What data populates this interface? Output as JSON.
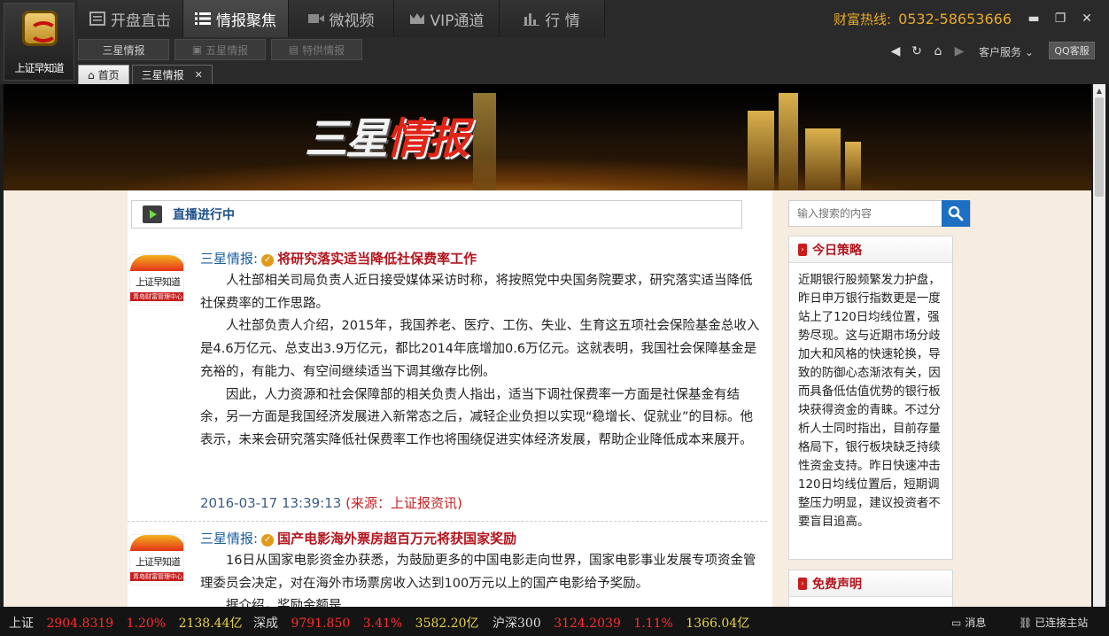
{
  "app": {
    "brand": "上证早知道",
    "hotline_label": "财富热线:",
    "hotline_number": "0532-58653666"
  },
  "main_nav": [
    {
      "label": "开盘直击",
      "icon": "list-icon"
    },
    {
      "label": "情报聚焦",
      "icon": "menu-list-icon"
    },
    {
      "label": "微视频",
      "icon": "video-camera-icon"
    },
    {
      "label": "VIP通道",
      "icon": "crown-icon"
    },
    {
      "label": "行 情",
      "icon": "bar-chart-icon"
    }
  ],
  "sub_nav": [
    {
      "label": "三星情报"
    },
    {
      "label": "五星情报"
    },
    {
      "label": "特供情报"
    }
  ],
  "toolbar": {
    "service_label": "客户服务",
    "qq_label": "QQ客服"
  },
  "doc_tabs": [
    {
      "label": "首页"
    },
    {
      "label": "三星情报"
    }
  ],
  "banner": {
    "title_white": "三星",
    "title_red": "情报"
  },
  "live": {
    "title": "直播进行中"
  },
  "news": [
    {
      "avatar_text": "上证早知道",
      "avatar_sub": "青岛财富管理中心",
      "source_label": "三星情报:",
      "headline": "将研究落实适当降低社保费率工作",
      "paragraphs": [
        "人社部相关司局负责人近日接受媒体采访时称，将按照党中央国务院要求，研究落实适当降低社保费率的工作思路。",
        "人社部负责人介绍，2015年，我国养老、医疗、工伤、失业、生育这五项社会保险基金总收入是4.6万亿元、总支出3.9万亿元，都比2014年底增加0.6万亿元。这就表明，我国社会保障基金是充裕的，有能力、有空间继续适当下调其缴存比例。",
        "因此，人力资源和社会保障部的相关负责人指出，适当下调社保费率一方面是社保基金有结余，另一方面是我国经济发展进入新常态之后，减轻企业负担以实现“稳增长、促就业”的目标。他表示，未来会研究落实降低社保费率工作也将围绕促进实体经济发展，帮助企业降低成本来展开。"
      ],
      "time": "2016-03-17 13:39:13",
      "origin": "(来源：上证报资讯)"
    },
    {
      "avatar_text": "上证早知道",
      "avatar_sub": "青岛财富管理中心",
      "source_label": "三星情报:",
      "headline": "国产电影海外票房超百万元将获国家奖励",
      "paragraphs": [
        "16日从国家电影资金办获悉，为鼓励更多的中国电影走向世界，国家电影事业发展专项资金管理委员会决定，对在海外市场票房收入达到100万元以上的国产电影给予奖励。",
        "据介绍，奖励金额是......"
      ]
    }
  ],
  "sidebar": {
    "search_placeholder": "输入搜索的内容",
    "strategy_title": "今日策略",
    "strategy_text": "近期银行股频繁发力护盘，昨日申万银行指数更是一度站上了120日均线位置，强势尽现。这与近期市场分歧加大和风格的快速轮换，导致的防御心态渐浓有关，因而具备低估值优势的银行板块获得资金的青睐。不过分析人士同时指出，目前存量格局下，银行板块缺乏持续性资金支持。昨日快速冲击120日均线位置后，短期调整压力明显，建议投资者不要盲目追高。",
    "disclaimer_title": "免费声明"
  },
  "ticker": [
    {
      "name": "上证",
      "value": "2904.8319",
      "change": "1.20%",
      "volume": "2138.44亿"
    },
    {
      "name": "深成",
      "value": "9791.850",
      "change": "3.41%",
      "volume": "3582.20亿"
    },
    {
      "name": "沪深300",
      "value": "3124.2039",
      "change": "1.11%",
      "volume": "1366.04亿"
    }
  ],
  "status": {
    "message_label": "消息",
    "connection_label": "已连接主站"
  },
  "colors": {
    "accent_gold": "#e8a92a",
    "headline_red": "#b3141d",
    "source_blue": "#1b5d9c",
    "search_blue": "#1d6fc2",
    "ticker_red": "#ff2e2e",
    "ticker_yellow": "#e8d24a"
  }
}
